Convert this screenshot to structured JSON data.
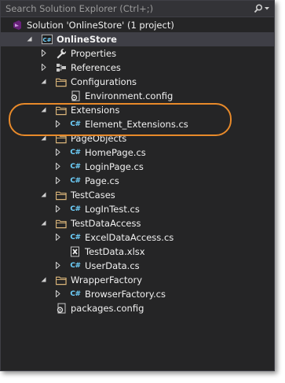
{
  "search": {
    "placeholder": "Search Solution Explorer (Ctrl+;)"
  },
  "tree": [
    {
      "key": "solution",
      "label": "Solution 'OnlineStore' (1 project)",
      "icon": "solution-icon",
      "arrow": "none"
    },
    {
      "key": "project",
      "label": "OnlineStore",
      "icon": "csharp-project-icon",
      "arrow": "expanded",
      "bold": true,
      "selected": true
    },
    {
      "key": "properties",
      "label": "Properties",
      "icon": "wrench-icon",
      "arrow": "collapsed"
    },
    {
      "key": "references",
      "label": "References",
      "icon": "references-icon",
      "arrow": "collapsed"
    },
    {
      "key": "configurations",
      "label": "Configurations",
      "icon": "folder-icon",
      "arrow": "expanded"
    },
    {
      "key": "environment-config",
      "label": "Environment.config",
      "icon": "config-file-icon",
      "arrow": "none"
    },
    {
      "key": "extensions",
      "label": "Extensions",
      "icon": "folder-icon",
      "arrow": "expanded"
    },
    {
      "key": "element-extensions",
      "label": "Element_Extensions.cs",
      "icon": "csharp-file-icon",
      "arrow": "collapsed"
    },
    {
      "key": "pageobjects",
      "label": "PageObjects",
      "icon": "folder-icon",
      "arrow": "expanded"
    },
    {
      "key": "homepage",
      "label": "HomePage.cs",
      "icon": "csharp-file-icon",
      "arrow": "collapsed"
    },
    {
      "key": "loginpage",
      "label": "LoginPage.cs",
      "icon": "csharp-file-icon",
      "arrow": "collapsed"
    },
    {
      "key": "page",
      "label": "Page.cs",
      "icon": "csharp-file-icon",
      "arrow": "collapsed"
    },
    {
      "key": "testcases",
      "label": "TestCases",
      "icon": "folder-icon",
      "arrow": "expanded"
    },
    {
      "key": "logintest",
      "label": "LogInTest.cs",
      "icon": "csharp-file-icon",
      "arrow": "collapsed"
    },
    {
      "key": "testdataaccess",
      "label": "TestDataAccess",
      "icon": "folder-icon",
      "arrow": "expanded"
    },
    {
      "key": "exceldataaccess",
      "label": "ExcelDataAccess.cs",
      "icon": "csharp-file-icon",
      "arrow": "collapsed"
    },
    {
      "key": "testdata",
      "label": "TestData.xlsx",
      "icon": "excel-file-icon",
      "arrow": "none"
    },
    {
      "key": "userdata",
      "label": "UserData.cs",
      "icon": "csharp-file-icon",
      "arrow": "collapsed"
    },
    {
      "key": "wrapperfactory",
      "label": "WrapperFactory",
      "icon": "folder-icon",
      "arrow": "expanded"
    },
    {
      "key": "browserfactory",
      "label": "BrowserFactory.cs",
      "icon": "csharp-file-icon",
      "arrow": "collapsed"
    },
    {
      "key": "packages-config",
      "label": "packages.config",
      "icon": "config-file-icon",
      "arrow": "none"
    }
  ],
  "colors": {
    "background": "#252526",
    "selection": "#3f3f46",
    "highlight_ring": "#e88a2a",
    "csharp_text": "#6fd2ff",
    "folder": "#dcb67a"
  }
}
